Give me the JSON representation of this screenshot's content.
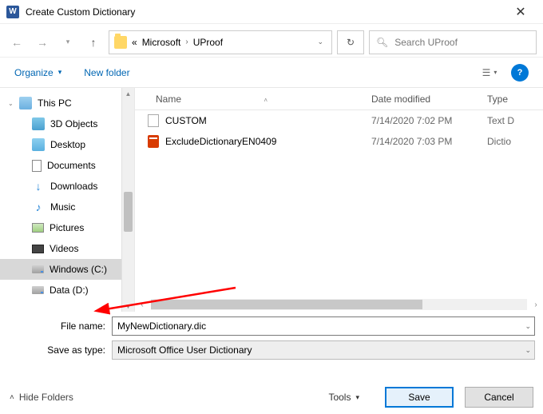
{
  "title": "Create Custom Dictionary",
  "breadcrumb": {
    "prefix": "«",
    "part1": "Microsoft",
    "part2": "UProof"
  },
  "search": {
    "placeholder": "Search UProof"
  },
  "toolbar": {
    "organize": "Organize",
    "newfolder": "New folder"
  },
  "tree": {
    "this_pc": "This PC",
    "objects3d": "3D Objects",
    "desktop": "Desktop",
    "documents": "Documents",
    "downloads": "Downloads",
    "music": "Music",
    "pictures": "Pictures",
    "videos": "Videos",
    "drive_c": "Windows (C:)",
    "drive_d": "Data (D:)"
  },
  "columns": {
    "name": "Name",
    "date": "Date modified",
    "type": "Type"
  },
  "files": [
    {
      "name": "CUSTOM",
      "date": "7/14/2020 7:02 PM",
      "type": "Text D",
      "icon": "txt"
    },
    {
      "name": "ExcludeDictionaryEN0409",
      "date": "7/14/2020 7:03 PM",
      "type": "Dictio",
      "icon": "office"
    }
  ],
  "form": {
    "filename_label": "File name:",
    "filename_value": "MyNewDictionary.dic",
    "savetype_label": "Save as type:",
    "savetype_value": "Microsoft Office User Dictionary"
  },
  "bottom": {
    "hide_folders": "Hide Folders",
    "tools": "Tools",
    "save": "Save",
    "cancel": "Cancel"
  }
}
